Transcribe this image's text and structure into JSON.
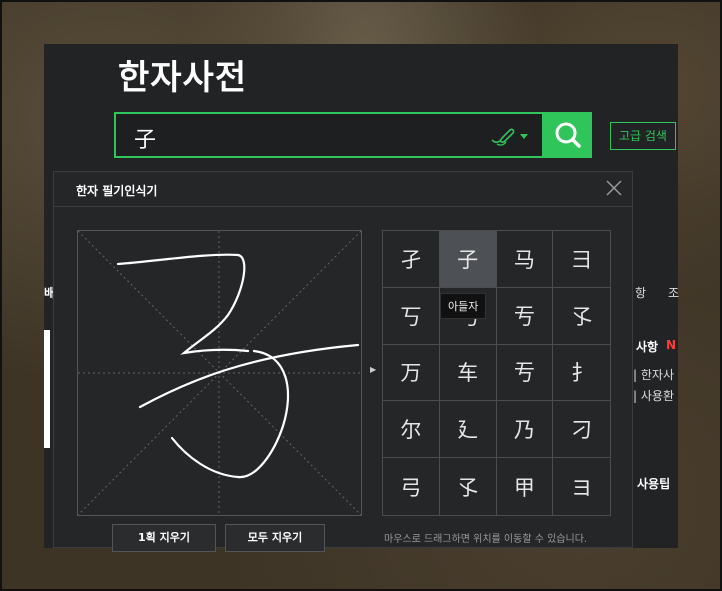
{
  "page": {
    "title": "한자사전",
    "search_value": "子",
    "advanced_search": "고급 검색"
  },
  "side": {
    "left_char": "배",
    "item_top": "항",
    "item_top2": "조",
    "notice_title": "사항",
    "notice_badge": "N",
    "notice_line1": "| 한자사",
    "notice_line2": "| 사용환",
    "tip": "사용팁"
  },
  "dialog": {
    "title": "한자 필기인식기",
    "candidates": [
      "孑",
      "子",
      "马",
      "彐",
      "丂",
      "丐",
      "亐",
      "孓",
      "万",
      "车",
      "亐",
      "扌",
      "尔",
      "廴",
      "乃",
      "刁",
      "弓",
      "孓",
      "甲",
      "ヨ"
    ],
    "selected_index": 1,
    "tooltip": "아들자",
    "clear_one": "1획 지우기",
    "clear_all": "모두 지우기",
    "hint": "마우스로 드래그하면 위치를 이동할 수 있습니다."
  },
  "colors": {
    "accent": "#2fc55a",
    "panel": "#212325",
    "dialog": "#242628"
  },
  "icons": {
    "handwriting": "pen-icon",
    "search": "search-icon",
    "close": "close-icon"
  }
}
